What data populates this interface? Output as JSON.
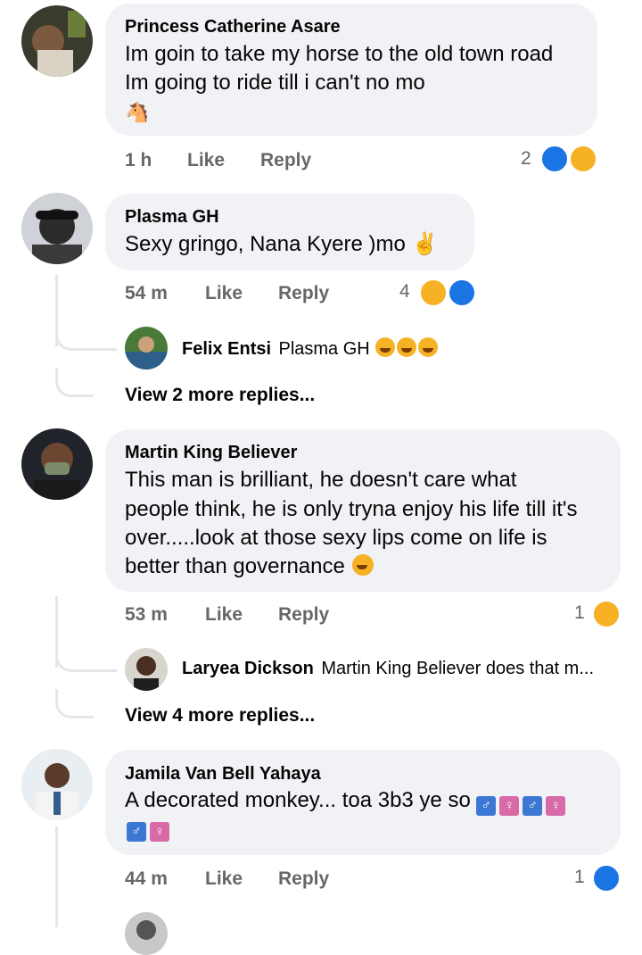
{
  "comments": [
    {
      "author": "Princess Catherine Asare",
      "lines": [
        "Im goin to take my horse to the old town road",
        "Im going to ride till i can't no mo",
        "🐴"
      ],
      "time": "1 h",
      "like": "Like",
      "reply": "Reply",
      "reaction_count": "2",
      "reactions": [
        "like-icon",
        "haha-icon"
      ]
    },
    {
      "author": "Plasma GH",
      "lines": [
        "Sexy gringo, Nana Kyere  )mo ✌"
      ],
      "time": "54 m",
      "like": "Like",
      "reply": "Reply",
      "reaction_count": "4",
      "reactions": [
        "haha-icon",
        "like-icon"
      ],
      "reply_preview": {
        "author": "Felix Entsi",
        "text": "Plasma GH"
      },
      "more_replies": "View 2 more replies..."
    },
    {
      "author": "Martin King Believer",
      "lines": [
        "This man is brilliant, he doesn't care what",
        "people think, he is only tryna enjoy his life till it's",
        "over.....look at those sexy lips come on life is",
        "better than governance"
      ],
      "time": "53 m",
      "like": "Like",
      "reply": "Reply",
      "reaction_count": "1",
      "reactions": [
        "haha-icon"
      ],
      "reply_preview": {
        "author": "Laryea Dickson",
        "text": "Martin King Believer  does that m..."
      },
      "more_replies": "View 4 more replies..."
    },
    {
      "author": "Jamila Van Bell Yahaya",
      "lines": [
        "A decorated monkey... toa 3b3 ye so"
      ],
      "time": "44 m",
      "like": "Like",
      "reply": "Reply",
      "reaction_count": "1",
      "reactions": [
        "like-icon"
      ]
    }
  ],
  "colors": {
    "bubble": "#f0f2f5",
    "meta": "#65676b",
    "like_blue": "#1b74e4",
    "haha_yellow": "#f7b125"
  }
}
